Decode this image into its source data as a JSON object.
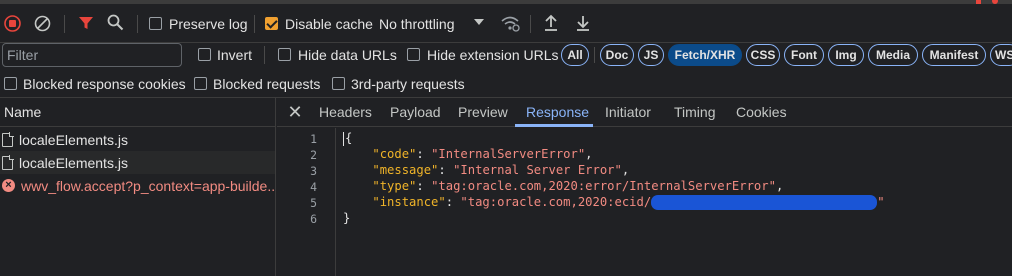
{
  "toolbar": {
    "preserve_log_label": "Preserve log",
    "preserve_log_checked": false,
    "disable_cache_label": "Disable cache",
    "disable_cache_checked": true,
    "throttling_label": "No throttling",
    "accent_color": "#f0a030",
    "record_color": "#e8453c",
    "icons": [
      "record-stop-icon",
      "clear-icon",
      "filter-icon",
      "search-icon",
      "wifi-settings-icon",
      "import-icon",
      "export-icon"
    ]
  },
  "filter": {
    "placeholder": "Filter",
    "invert_label": "Invert",
    "hide_data_urls_label": "Hide data URLs",
    "hide_extension_urls_label": "Hide extension URLs",
    "types": [
      "All",
      "Doc",
      "JS",
      "Fetch/XHR",
      "CSS",
      "Font",
      "Img",
      "Media",
      "Manifest",
      "WS"
    ],
    "active_type": "Fetch/XHR"
  },
  "options": {
    "blocked_response_cookies_label": "Blocked response cookies",
    "blocked_requests_label": "Blocked requests",
    "third_party_requests_label": "3rd-party requests"
  },
  "requests": {
    "header": "Name",
    "items": [
      {
        "name": "localeElements.js",
        "status": "ok"
      },
      {
        "name": "localeElements.js",
        "status": "ok"
      },
      {
        "name": "wwv_flow.accept?p_context=app-builde...",
        "status": "error"
      }
    ]
  },
  "details": {
    "tabs": [
      "Headers",
      "Payload",
      "Preview",
      "Response",
      "Initiator",
      "Timing",
      "Cookies"
    ],
    "active_tab": "Response",
    "response_lines": {
      "l1": "{",
      "l2_key": "\"code\"",
      "l2_val": "\"InternalServerError\"",
      "l3_key": "\"message\"",
      "l3_val": "\"Internal Server Error\"",
      "l4_key": "\"type\"",
      "l4_val": "\"tag:oracle.com,2020:error/InternalServerError\"",
      "l5_key": "\"instance\"",
      "l5_val_prefix": "\"tag:oracle.com,2020:ecid/",
      "l5_val_suffix": "\"",
      "l6": "}"
    },
    "line_numbers": [
      "1",
      "2",
      "3",
      "4",
      "5",
      "6"
    ]
  }
}
